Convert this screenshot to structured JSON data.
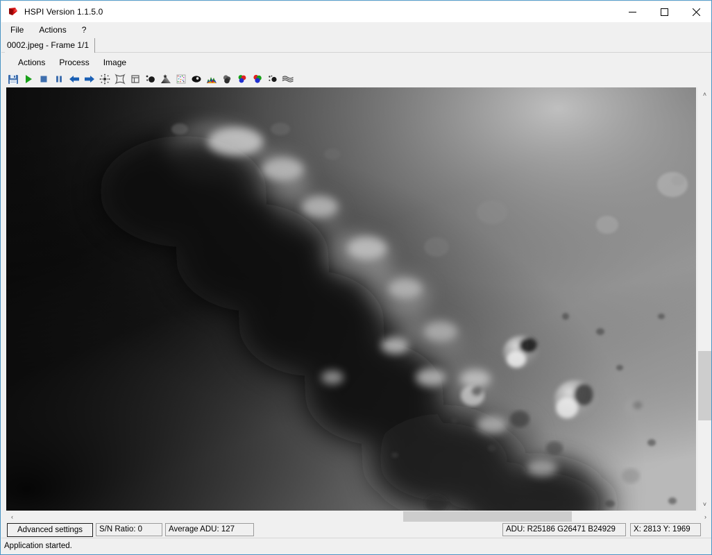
{
  "window": {
    "title": "HSPI Version 1.1.5.0",
    "app_icon": "hspi-app-icon",
    "controls": {
      "minimize": "—",
      "maximize": "□",
      "close": "✕"
    },
    "accent_border": "#4a94c4"
  },
  "menubar": {
    "items": [
      {
        "label": "File",
        "name": "menu-file"
      },
      {
        "label": "Actions",
        "name": "menu-actions"
      },
      {
        "label": "?",
        "name": "menu-help"
      }
    ]
  },
  "tabstrip": {
    "tabs": [
      {
        "label": "0002.jpeg - Frame 1/1",
        "active": true
      }
    ]
  },
  "inner_menubar": {
    "items": [
      {
        "label": "Actions",
        "name": "inner-menu-actions"
      },
      {
        "label": "Process",
        "name": "inner-menu-process"
      },
      {
        "label": "Image",
        "name": "inner-menu-image"
      }
    ]
  },
  "toolbar": {
    "buttons": [
      {
        "icon": "save-icon",
        "tip": "Save"
      },
      {
        "icon": "play-icon",
        "tip": "Start"
      },
      {
        "icon": "stop-icon",
        "tip": "Stop"
      },
      {
        "icon": "pause-icon",
        "tip": "Pause"
      },
      {
        "icon": "arrow-left-icon",
        "tip": "Previous frame"
      },
      {
        "icon": "arrow-right-icon",
        "tip": "Next frame"
      },
      {
        "icon": "dark-frame-icon",
        "tip": "Dark frame"
      },
      {
        "icon": "flat-field-icon",
        "tip": "Flat field"
      },
      {
        "icon": "bias-frame-icon",
        "tip": "Bias frame"
      },
      {
        "icon": "hot-pixel-icon",
        "tip": "Hot pixel removal"
      },
      {
        "icon": "gradient-remove-icon",
        "tip": "Gradient removal"
      },
      {
        "icon": "noise-reduce-icon",
        "tip": "Noise reduction"
      },
      {
        "icon": "contrast-icon",
        "tip": "Contrast"
      },
      {
        "icon": "histogram-icon",
        "tip": "Histogram"
      },
      {
        "icon": "blur-icon",
        "tip": "Blur"
      },
      {
        "icon": "rgb-align-icon",
        "tip": "RGB align"
      },
      {
        "icon": "rgb-balance-icon",
        "tip": "RGB balance"
      },
      {
        "icon": "despeckle-icon",
        "tip": "Despeckle"
      },
      {
        "icon": "wavelet-icon",
        "tip": "Wavelet sharpen"
      }
    ]
  },
  "canvas": {
    "name": "image-viewport",
    "alt": "moon-terminator-grayscale-image"
  },
  "scrollbars": {
    "vertical": {
      "up": "˄",
      "down": "˅"
    },
    "horizontal": {
      "left": "‹",
      "right": "›"
    }
  },
  "bottom_panel": {
    "advanced_settings_label": "Advanced settings",
    "sn_ratio": "S/N Ratio: 0",
    "average_adu": "Average ADU: 127",
    "adu_rgb": "ADU: R25186 G26471 B24929",
    "cursor_xy": "X: 2813 Y: 1969"
  },
  "statusbar": {
    "message": "Application started."
  }
}
